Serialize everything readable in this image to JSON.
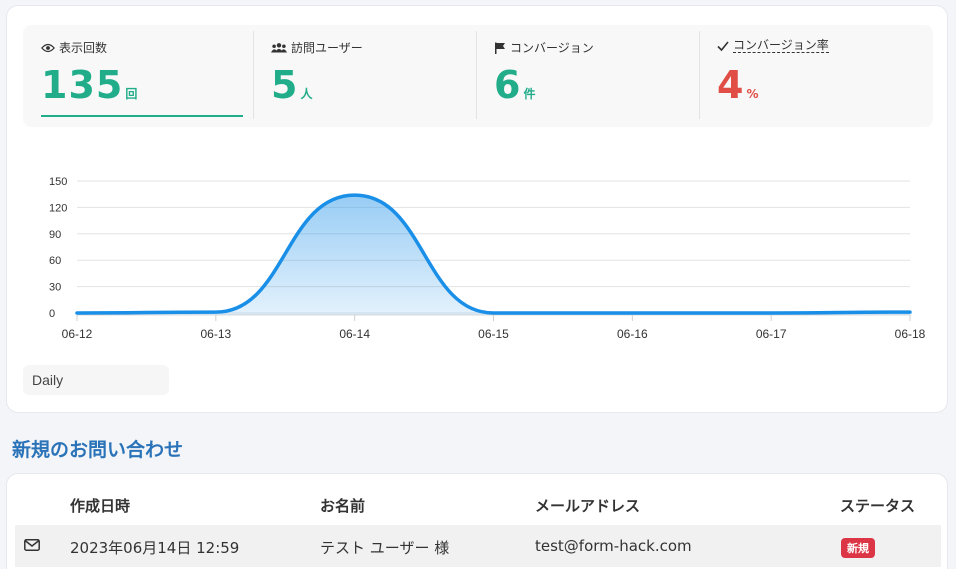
{
  "metrics": [
    {
      "icon": "eye-icon",
      "label": "表示回数",
      "value": "135",
      "unit": "回",
      "color": "#21ad8a"
    },
    {
      "icon": "users-icon",
      "label": "訪問ユーザー",
      "value": "5",
      "unit": "人",
      "color": "#21ad8a"
    },
    {
      "icon": "flag-icon",
      "label": "コンバージョン",
      "value": "6",
      "unit": "件",
      "color": "#21ad8a"
    },
    {
      "icon": "check-icon",
      "label": "コンバージョン率",
      "value": "4",
      "unit": "%",
      "color": "#e04e46"
    }
  ],
  "chart_data": {
    "type": "area",
    "x": [
      "06-12",
      "06-13",
      "06-14",
      "06-15",
      "06-16",
      "06-17",
      "06-18"
    ],
    "series": [
      {
        "values": [
          0,
          1,
          134,
          0,
          0,
          0,
          1
        ]
      }
    ],
    "yticks": [
      0,
      30,
      60,
      90,
      120,
      150
    ],
    "ylim": [
      0,
      150
    ],
    "grid": true,
    "color": "#1a8fe8"
  },
  "range_select": {
    "value": "Daily"
  },
  "inquiries": {
    "title": "新規のお問い合わせ",
    "columns": [
      "作成日時",
      "お名前",
      "メールアドレス",
      "ステータス"
    ],
    "rows": [
      {
        "icon": "envelope-icon",
        "created": "2023年06月14日 12:59",
        "name": "テスト ユーザー 様",
        "email": "test@form-hack.com",
        "status": "新規"
      }
    ]
  }
}
